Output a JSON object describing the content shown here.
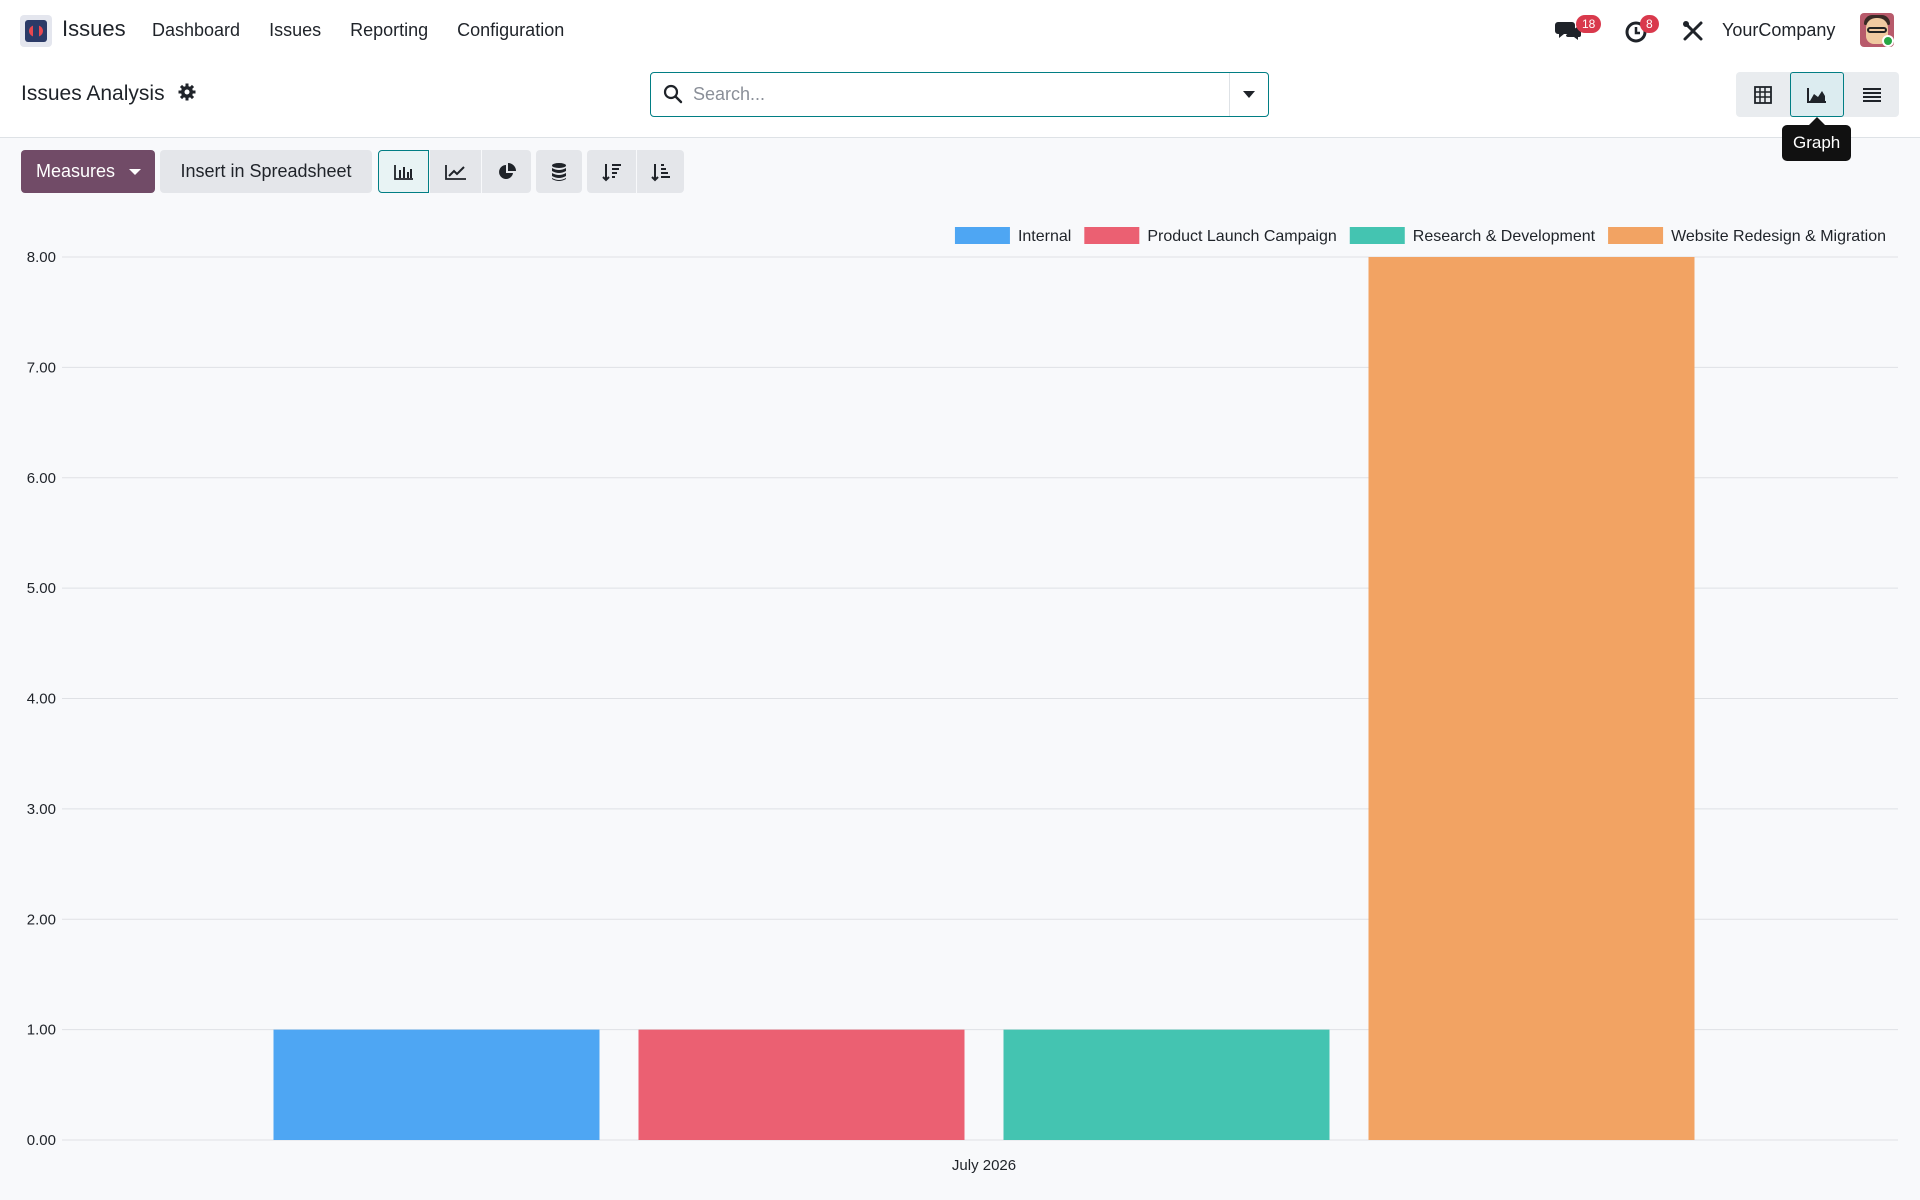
{
  "app": {
    "name": "Issues",
    "icon": "issues-app-icon"
  },
  "menu": {
    "items": [
      "Dashboard",
      "Issues",
      "Reporting",
      "Configuration"
    ]
  },
  "systray": {
    "messages_badge": "18",
    "activities_badge": "8",
    "company": "YourCompany"
  },
  "control": {
    "title": "Issues Analysis",
    "search_placeholder": "Search...",
    "tooltip": "Graph",
    "views": [
      "pivot-icon",
      "graph-icon",
      "list-icon"
    ],
    "active_view": "graph"
  },
  "toolbar": {
    "measures_label": "Measures",
    "insert_label": "Insert in Spreadsheet"
  },
  "colors": {
    "accent": "#714b67",
    "teal": "#017e84",
    "badge": "#d9394c"
  },
  "chart_data": {
    "type": "bar",
    "categories": [
      "July 2026"
    ],
    "series": [
      {
        "name": "Internal",
        "values": [
          1
        ],
        "color": "#4ea6f3"
      },
      {
        "name": "Product Launch Campaign",
        "values": [
          1
        ],
        "color": "#eb6072"
      },
      {
        "name": "Research & Development",
        "values": [
          1
        ],
        "color": "#44c4b1"
      },
      {
        "name": "Website Redesign & Migration",
        "values": [
          8
        ],
        "color": "#f2a363"
      }
    ],
    "yticks": [
      "0.00",
      "1.00",
      "2.00",
      "3.00",
      "4.00",
      "5.00",
      "6.00",
      "7.00",
      "8.00"
    ],
    "ylim": [
      0,
      8
    ],
    "grid": true,
    "legend": "top-right",
    "xlabel": "",
    "ylabel": "",
    "title": ""
  }
}
